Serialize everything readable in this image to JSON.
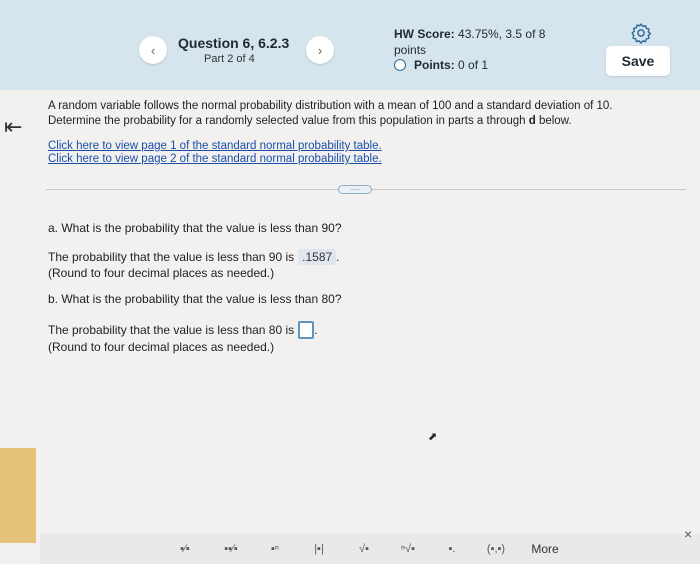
{
  "header": {
    "prev_glyph": "‹",
    "next_glyph": "›",
    "question_title": "Question 6, 6.2.3",
    "question_part": "Part 2 of 4",
    "hw_score_label": "HW Score:",
    "hw_score_value": "43.75%, 3.5 of 8",
    "hw_score_unit": "points",
    "points_label": "Points:",
    "points_value": "0 of 1",
    "save_label": "Save",
    "settings_icon": "gear-icon"
  },
  "sidebar": {
    "back_glyph": "⇤",
    "accent_color": "#e5c27a"
  },
  "problem": {
    "prompt_line1": "A random variable follows the normal probability distribution with a mean of 100 and a standard deviation of 10.",
    "prompt_line2_pre": "Determine the probability for a randomly selected value from this population in parts a through ",
    "prompt_line2_bold": "d",
    "prompt_line2_post": " below.",
    "link1": "Click here to view page 1 of the standard normal probability table.",
    "link2": "Click here to view page 2 of the standard normal probability table.",
    "expand_dots": "....."
  },
  "part_a": {
    "question": "a. What is the probability that the value is less than 90?",
    "answer_prefix": "The probability that the value is less than 90 is",
    "answer_value": ".1587",
    "answer_suffix": ".",
    "round_note": "(Round to four decimal places as needed.)"
  },
  "part_b": {
    "question": "b. What is the probability that the value is less than 80?",
    "answer_prefix": "The probability that the value is less than 80 is",
    "answer_value": "",
    "answer_suffix": ".",
    "round_note": "(Round to four decimal places as needed.)"
  },
  "toolbar": {
    "tools": [
      "fraction",
      "mixed-number",
      "exponent",
      "absolute-value",
      "square-root",
      "nth-root",
      "decimal",
      "ordered-pair"
    ],
    "tool_glyphs": [
      "▪⁄▪",
      "▪▪⁄▪",
      "▪ⁿ",
      "|▪|",
      "√▪",
      "ⁿ√▪",
      "▪.",
      "(▪,▪)"
    ],
    "more_label": "More",
    "close_glyph": "×"
  }
}
